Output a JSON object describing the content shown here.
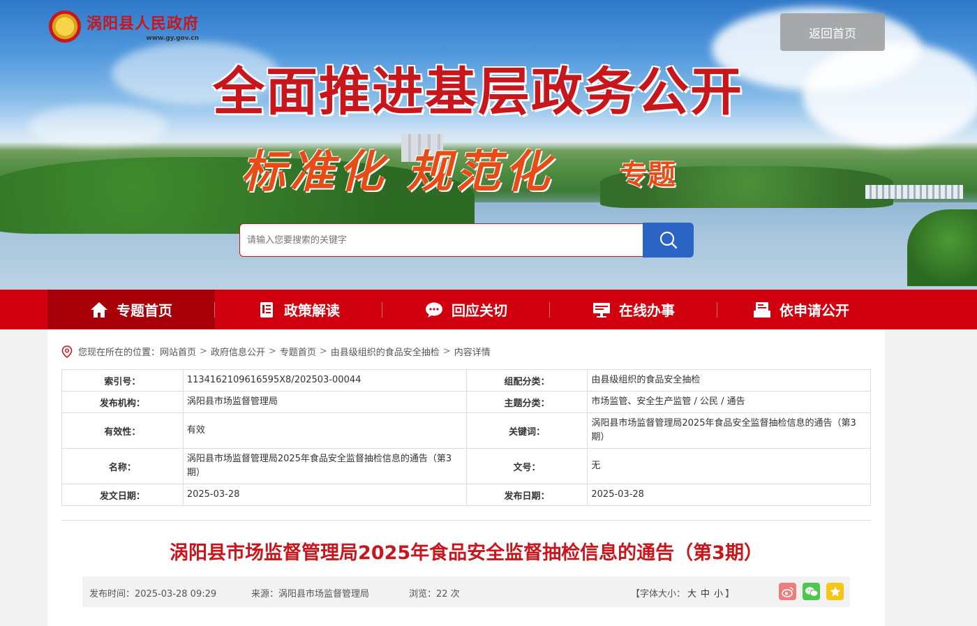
{
  "header": {
    "site_name": "涡阳县人民政府",
    "site_url": "www.gy.gov.cn",
    "home_button": "返回首页",
    "main_title": "全面推进基层政务公开",
    "slogan": "标准化 规范化",
    "slogan_suffix": "专题",
    "search_placeholder": "请输入您要搜索的关键字"
  },
  "nav": {
    "items": [
      {
        "label": "专题首页",
        "icon": "home-icon",
        "active": true
      },
      {
        "label": "政策解读",
        "icon": "document-icon",
        "active": false
      },
      {
        "label": "回应关切",
        "icon": "chat-icon",
        "active": false
      },
      {
        "label": "在线办事",
        "icon": "monitor-icon",
        "active": false
      },
      {
        "label": "依申请公开",
        "icon": "request-icon",
        "active": false
      }
    ]
  },
  "breadcrumb": {
    "prefix": "您现在所在的位置：",
    "items": [
      "网站首页",
      "政府信息公开",
      "专题首页",
      "由县级组织的食品安全抽检",
      "内容详情"
    ]
  },
  "meta": {
    "index_label": "索引号：",
    "index_value": "1134162109616595X8/202503-00044",
    "group_label": "组配分类：",
    "group_value": "由县级组织的食品安全抽检",
    "org_label": "发布机构：",
    "org_value": "涡阳县市场监督管理局",
    "topic_label": "主题分类：",
    "topic_value": "市场监管、安全生产监管 / 公民 / 通告",
    "validity_label": "有效性：",
    "validity_value": "有效",
    "keywords_label": "关键词：",
    "keywords_value": "涡阳县市场监督管理局2025年食品安全监督抽检信息的通告（第3期）",
    "name_label": "名称：",
    "name_value": "涡阳县市场监督管理局2025年食品安全监督抽检信息的通告（第3期）",
    "docno_label": "文号：",
    "docno_value": "无",
    "issue_date_label": "发文日期：",
    "issue_date_value": "2025-03-28",
    "publish_date_label": "发布日期：",
    "publish_date_value": "2025-03-28"
  },
  "article": {
    "title": "涡阳县市场监督管理局2025年食品安全监督抽检信息的通告（第3期）",
    "publish_time": "发布时间：2025-03-28 09:29",
    "source": "来源：涡阳县市场监督管理局",
    "views": "浏览：22 次",
    "font_size_prefix": "【字体大小：",
    "font_large": "大",
    "font_medium": "中",
    "font_small": "小",
    "font_size_suffix": "】"
  },
  "share": [
    {
      "name": "weibo-share-icon",
      "color": "#f08080"
    },
    {
      "name": "wechat-share-icon",
      "color": "#4cc94c"
    },
    {
      "name": "favorite-icon",
      "color": "#f5c518"
    }
  ],
  "colors": {
    "brand_red": "#d1000f",
    "title_red": "#c8161d",
    "search_blue": "#2a64c5"
  }
}
